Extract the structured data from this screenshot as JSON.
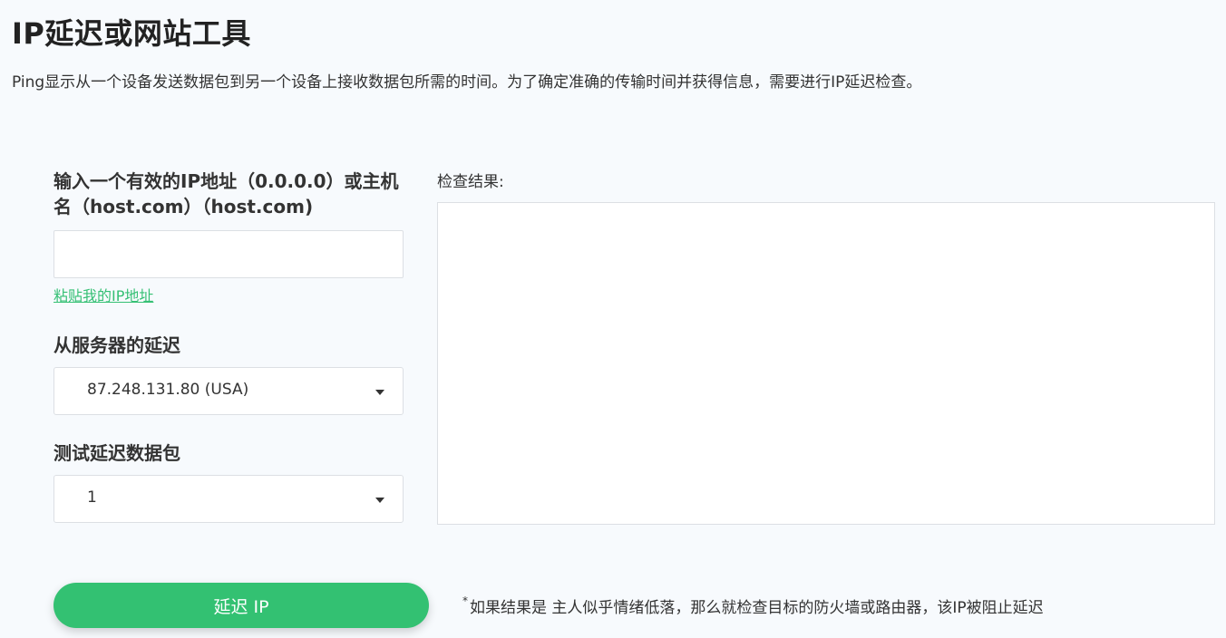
{
  "page": {
    "title": "IP延迟或网站工具",
    "description": "Ping显示从一个设备发送数据包到另一个设备上接收数据包所需的时间。为了确定准确的传输时间并获得信息，需要进行IP延迟检查。"
  },
  "form": {
    "host_label": "输入一个有效的IP地址（0.0.0.0）或主机名（host.com）（host.com)",
    "host_value": "",
    "host_placeholder": "",
    "paste_link": "粘贴我的IP地址",
    "server_label": "从服务器的延迟",
    "server_selected": "87.248.131.80 (USA)",
    "packets_label": "测试延迟数据包",
    "packets_selected": "1"
  },
  "results": {
    "label": "检查结果:",
    "content": ""
  },
  "action": {
    "button_label": "延迟 IP",
    "note_star": "*",
    "note": "如果结果是 主人似乎情绪低落，那么就检查目标的防火墙或路由器，该IP被阻止延迟"
  },
  "colors": {
    "accent": "#33c172",
    "link": "#35c074",
    "background": "#f7fafd"
  },
  "icons": {
    "dropdown": "chevron-down-icon"
  }
}
